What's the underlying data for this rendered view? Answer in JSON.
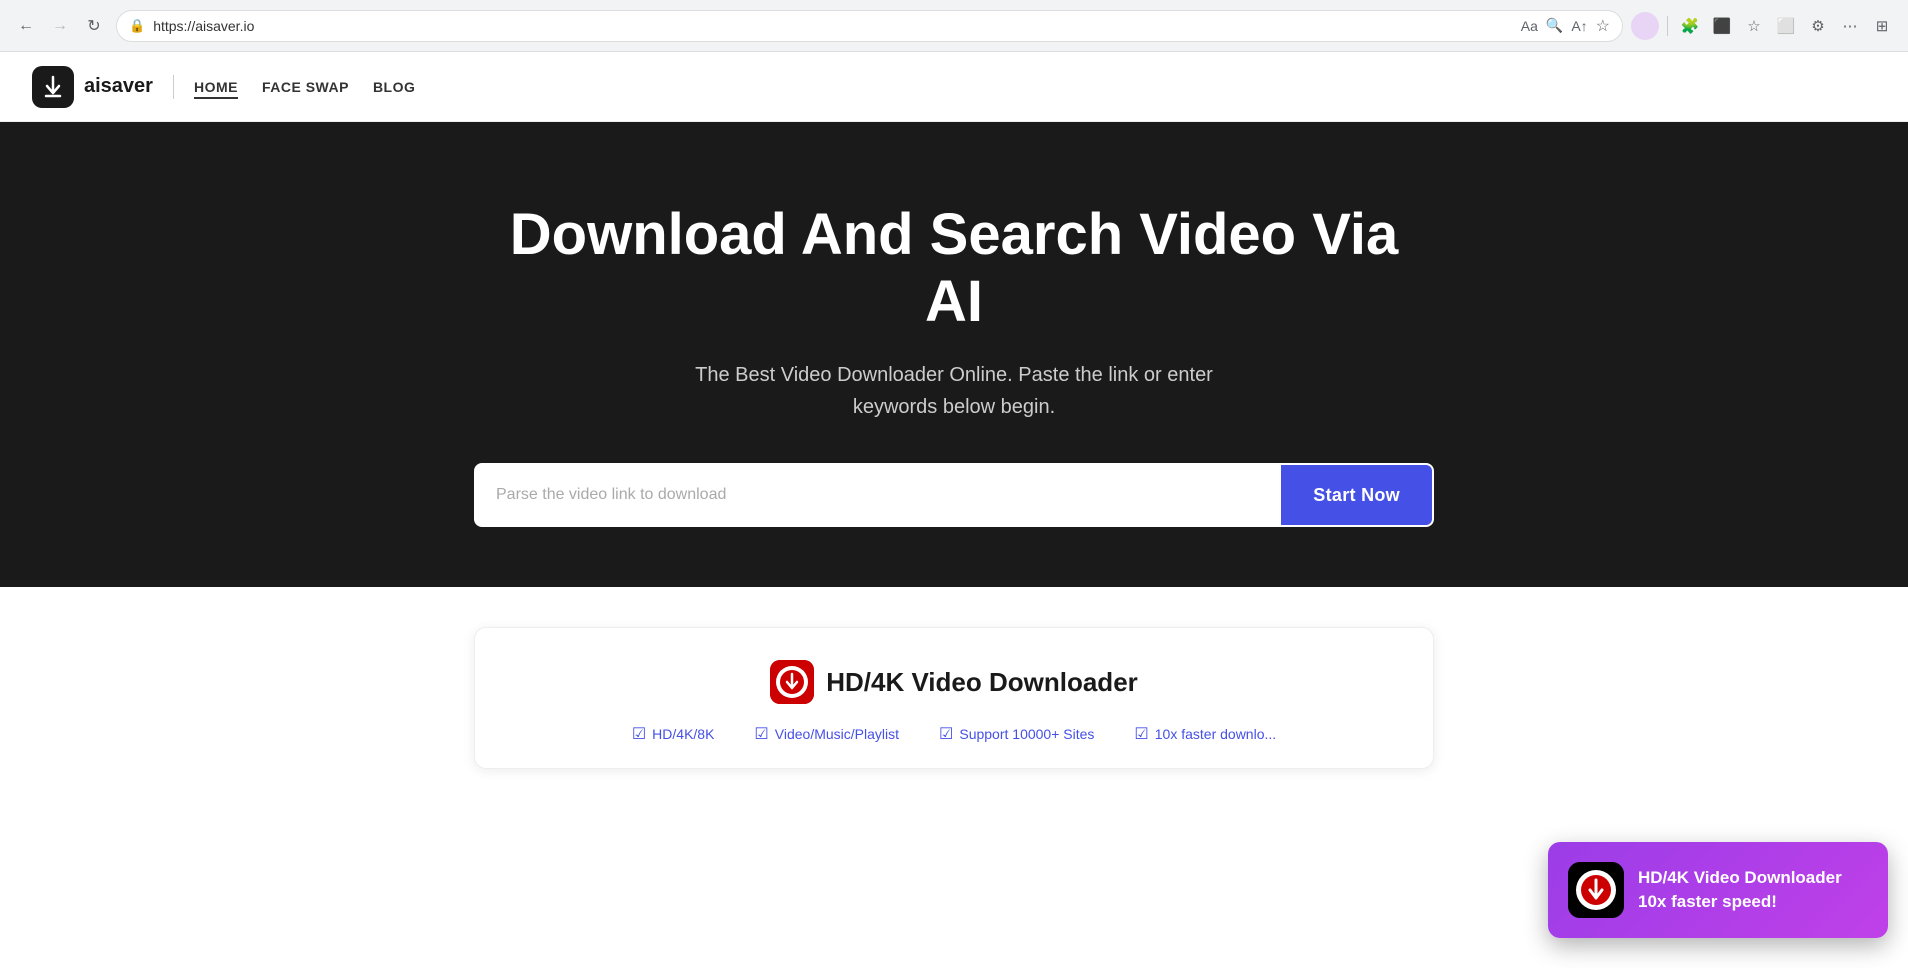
{
  "browser": {
    "url": "https://aisaver.io",
    "back_label": "←",
    "forward_label": "→",
    "refresh_label": "↻"
  },
  "header": {
    "logo_text": "aisaver",
    "logo_icon": "⬇",
    "nav_items": [
      {
        "label": "HOME",
        "active": true
      },
      {
        "label": "FACE SWAP",
        "active": false
      },
      {
        "label": "BLOG",
        "active": false
      }
    ]
  },
  "hero": {
    "title": "Download And Search Video Via AI",
    "subtitle": "The Best Video Downloader Online. Paste the link or enter keywords below begin.",
    "search_placeholder": "Parse the video link to download",
    "cta_label": "Start Now"
  },
  "feature_card": {
    "app_icon_alt": "HD/4K Video Downloader App Icon",
    "title": "HD/4K Video Downloader",
    "features": [
      {
        "label": "HD/4K/8K",
        "checked": true
      },
      {
        "label": "Video/Music/Playlist",
        "checked": true
      },
      {
        "label": "Support 10000+ Sites",
        "checked": true
      },
      {
        "label": "10x faster downlo...",
        "checked": true
      }
    ]
  },
  "popup": {
    "title": "HD/4K Video Downloader",
    "subtitle": "10x faster speed!"
  }
}
